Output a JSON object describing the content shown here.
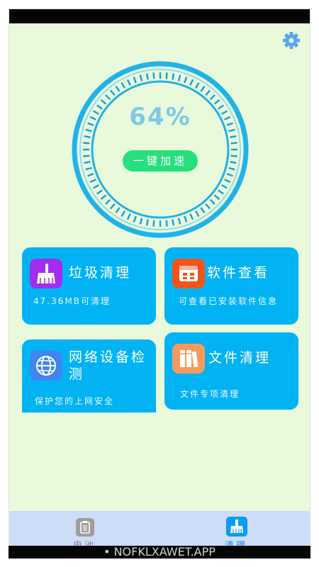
{
  "meter": {
    "percent": "64%",
    "boost_label": "一键加速"
  },
  "settings": {
    "icon": "gear-icon"
  },
  "cards": [
    {
      "title": "垃圾清理",
      "subtitle": "47.36MB可清理",
      "icon": "broom-icon",
      "icon_color": "#a22cf0"
    },
    {
      "title": "软件查看",
      "subtitle": "可查看已安装软件信息",
      "icon": "calendar-icon",
      "icon_color": "#f4531a"
    },
    {
      "title": "网络设备检测",
      "subtitle": "保护您的上网安全",
      "icon": "globe-icon",
      "icon_color": "#3f86f0"
    },
    {
      "title": "文件清理",
      "subtitle": "文件专项清理",
      "icon": "books-icon",
      "icon_color": "#f59a5c"
    }
  ],
  "tabs": [
    {
      "label": "电池",
      "icon": "clipboard-icon",
      "active": false
    },
    {
      "label": "清理",
      "icon": "broom-icon",
      "active": true
    }
  ],
  "footer": {
    "watermark": "• NOFKLXAWET.APP"
  },
  "colors": {
    "background": "#e8fadb",
    "card": "#02b3f4",
    "ring": "#22b2ea",
    "boost": "#27e07d",
    "tabbar": "#cddcf7"
  }
}
